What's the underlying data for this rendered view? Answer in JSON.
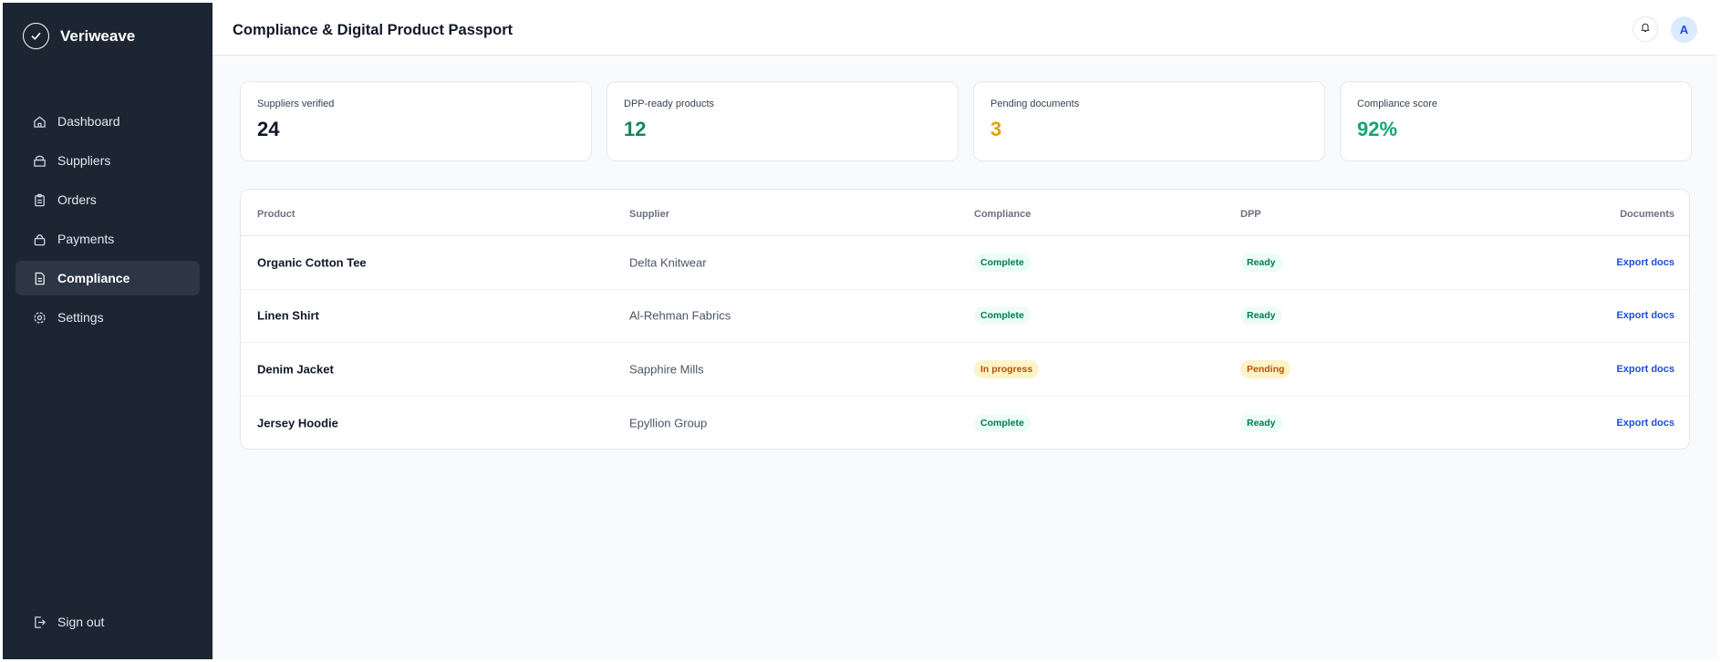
{
  "brand": {
    "name": "Veriweave"
  },
  "sidebar": {
    "items": [
      {
        "label": "Dashboard",
        "icon": "home-icon",
        "active": false
      },
      {
        "label": "Suppliers",
        "icon": "package-icon",
        "active": false
      },
      {
        "label": "Orders",
        "icon": "clipboard-icon",
        "active": false
      },
      {
        "label": "Payments",
        "icon": "lock-icon",
        "active": false
      },
      {
        "label": "Compliance",
        "icon": "document-icon",
        "active": true
      },
      {
        "label": "Settings",
        "icon": "gear-icon",
        "active": false
      }
    ],
    "signout_label": "Sign out"
  },
  "header": {
    "title": "Compliance & Digital Product Passport",
    "avatar_initial": "A"
  },
  "stats": [
    {
      "label": "Suppliers verified",
      "value": "24",
      "color": "#111827"
    },
    {
      "label": "DPP-ready products",
      "value": "12",
      "color": "#0f8a5f"
    },
    {
      "label": "Pending documents",
      "value": "3",
      "color": "#e0a30b"
    },
    {
      "label": "Compliance score",
      "value": "92%",
      "color": "#10a672"
    }
  ],
  "table": {
    "columns": [
      "Product",
      "Supplier",
      "Compliance",
      "DPP",
      "Documents"
    ],
    "rows": [
      {
        "product": "Organic Cotton Tee",
        "supplier": "Delta Knitwear",
        "compliance": "Complete",
        "dpp": "Ready",
        "documents": "Export docs"
      },
      {
        "product": "Linen Shirt",
        "supplier": "Al-Rehman Fabrics",
        "compliance": "Complete",
        "dpp": "Ready",
        "documents": "Export docs"
      },
      {
        "product": "Denim Jacket",
        "supplier": "Sapphire Mills",
        "compliance": "In progress",
        "dpp": "Pending",
        "documents": "Export docs"
      },
      {
        "product": "Jersey Hoodie",
        "supplier": "Epyllion Group",
        "compliance": "Complete",
        "dpp": "Ready",
        "documents": "Export docs"
      }
    ]
  },
  "colors": {
    "sidebar_bg": "#1c2532",
    "sidebar_active": "#2d3644",
    "link": "#1d4ed8",
    "badge_green_text": "#047857",
    "badge_amber_text": "#b45309"
  }
}
